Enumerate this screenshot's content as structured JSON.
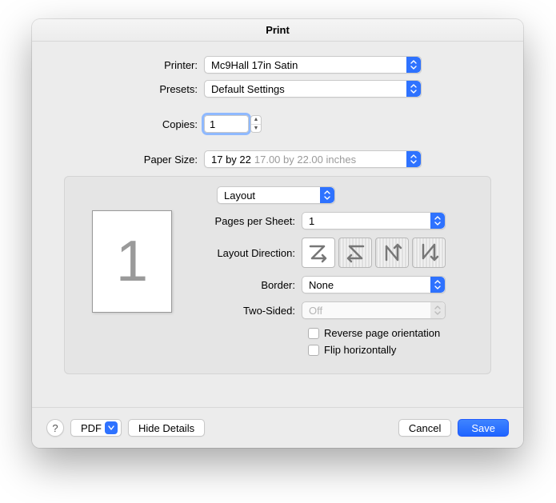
{
  "title": "Print",
  "labels": {
    "printer": "Printer:",
    "presets": "Presets:",
    "copies": "Copies:",
    "paper_size": "Paper Size:",
    "pages_per_sheet": "Pages per Sheet:",
    "layout_direction": "Layout Direction:",
    "border": "Border:",
    "two_sided": "Two-Sided:"
  },
  "printer": {
    "selected": "Mc9Hall 17in Satin"
  },
  "presets": {
    "selected": "Default Settings"
  },
  "copies": {
    "value": "1"
  },
  "paper_size": {
    "selected": "17 by 22",
    "detail": "17.00 by 22.00 inches"
  },
  "section": {
    "selected": "Layout"
  },
  "preview": {
    "page_number": "1"
  },
  "pages_per_sheet": {
    "selected": "1"
  },
  "border": {
    "selected": "None"
  },
  "two_sided": {
    "selected": "Off"
  },
  "checkboxes": {
    "reverse": "Reverse page orientation",
    "flip": "Flip horizontally"
  },
  "footer": {
    "help": "?",
    "pdf": "PDF",
    "hide_details": "Hide Details",
    "cancel": "Cancel",
    "save": "Save"
  }
}
